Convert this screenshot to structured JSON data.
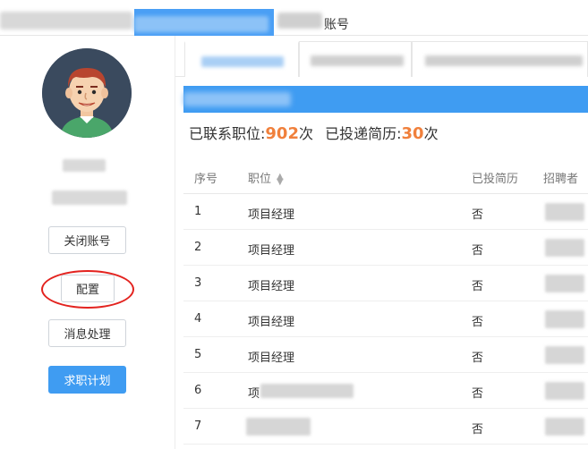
{
  "topnav": {
    "account_tab_label": "账号"
  },
  "sidebar": {
    "buttons": [
      {
        "label": "关闭账号"
      },
      {
        "label": "配置"
      },
      {
        "label": "消息处理"
      },
      {
        "label": "求职计划"
      }
    ]
  },
  "stats": {
    "contacted_label": "已联系职位:",
    "contacted_count": "902",
    "contacted_unit": "次",
    "applied_label": "已投递简历:",
    "applied_count": "30",
    "applied_unit": "次"
  },
  "table": {
    "headers": {
      "index": "序号",
      "position": "职位",
      "applied": "已投简历",
      "recruiter": "招聘者"
    },
    "rows": [
      {
        "index": "1",
        "position": "项目经理",
        "applied": "否"
      },
      {
        "index": "2",
        "position": "项目经理",
        "applied": "否"
      },
      {
        "index": "3",
        "position": "项目经理",
        "applied": "否"
      },
      {
        "index": "4",
        "position": "项目经理",
        "applied": "否"
      },
      {
        "index": "5",
        "position": "项目经理",
        "applied": "否"
      },
      {
        "index": "6",
        "position": "项",
        "applied": "否"
      },
      {
        "index": "7",
        "position": "",
        "applied": "否"
      }
    ]
  },
  "colors": {
    "primary": "#3f9cf2",
    "highlight_number": "#f0803c",
    "annotation_circle": "#e3231f"
  }
}
